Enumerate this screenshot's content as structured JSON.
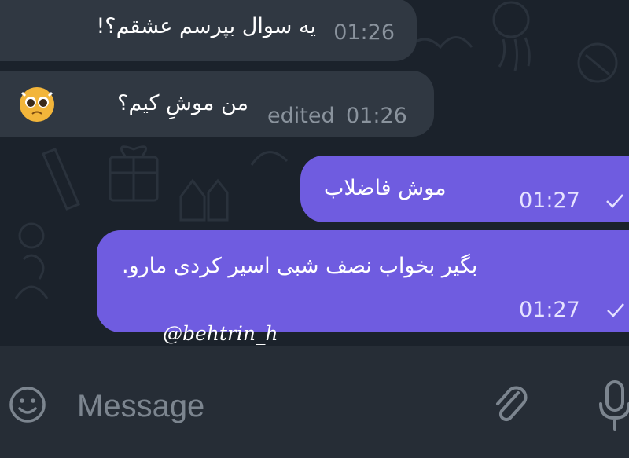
{
  "messages": [
    {
      "direction": "incoming",
      "text": "یه سوال بپرسم عشقم؟!",
      "time": "01:26"
    },
    {
      "direction": "incoming",
      "text": "من موشِ کیم؟",
      "time": "01:26",
      "edited_label": "edited",
      "emoji": "pleading-face-emoji"
    },
    {
      "direction": "outgoing",
      "text": "موش فاضلاب",
      "time": "01:27",
      "status": "sent-check"
    },
    {
      "direction": "outgoing",
      "text": "بگیر بخواب نصف شبی اسیر کردی مارو.",
      "time": "01:27",
      "status": "sent-check"
    }
  ],
  "watermark": "@behtrin_h",
  "composer": {
    "placeholder": "Message",
    "emoji_icon": "smiley-icon",
    "attach_icon": "paperclip-icon",
    "voice_icon": "microphone-icon"
  },
  "colors": {
    "chat_background": "#1b222b",
    "incoming_bubble": "#303842",
    "outgoing_bubble": "#6f5ce0",
    "input_bar": "#262d36"
  }
}
